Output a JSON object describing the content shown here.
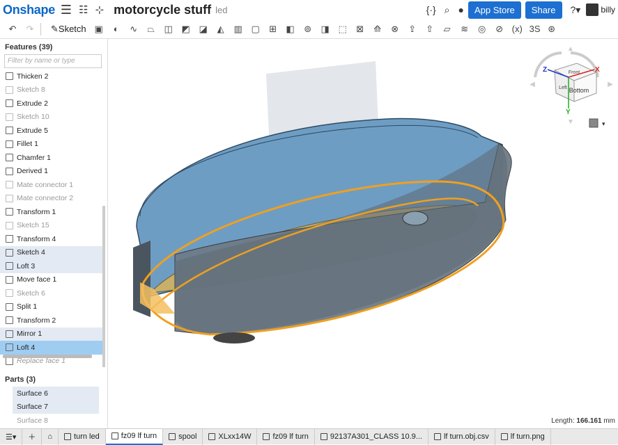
{
  "header": {
    "logo": "Onshape",
    "doc_title": "motorcycle stuff",
    "doc_subtitle": "led",
    "app_store": "App Store",
    "share": "Share",
    "user": "billy"
  },
  "toolbar": {
    "sketch": "Sketch"
  },
  "features": {
    "heading": "Features (39)",
    "filter_placeholder": "Filter by name or type",
    "items": [
      {
        "label": "Thicken 2",
        "state": "normal"
      },
      {
        "label": "Sketch 8",
        "state": "dim"
      },
      {
        "label": "Extrude 2",
        "state": "normal"
      },
      {
        "label": "Sketch 10",
        "state": "dim"
      },
      {
        "label": "Extrude 5",
        "state": "normal"
      },
      {
        "label": "Fillet 1",
        "state": "normal"
      },
      {
        "label": "Chamfer 1",
        "state": "normal"
      },
      {
        "label": "Derived 1",
        "state": "normal"
      },
      {
        "label": "Mate connector 1",
        "state": "dim"
      },
      {
        "label": "Mate connector 2",
        "state": "dim"
      },
      {
        "label": "Transform 1",
        "state": "normal"
      },
      {
        "label": "Sketch 15",
        "state": "dim"
      },
      {
        "label": "Transform 4",
        "state": "normal"
      },
      {
        "label": "Sketch 4",
        "state": "hl"
      },
      {
        "label": "Loft 3",
        "state": "hl"
      },
      {
        "label": "Move face 1",
        "state": "normal"
      },
      {
        "label": "Sketch 6",
        "state": "dim"
      },
      {
        "label": "Split 1",
        "state": "normal"
      },
      {
        "label": "Transform 2",
        "state": "normal"
      },
      {
        "label": "Mirror 1",
        "state": "hl"
      },
      {
        "label": "Loft 4",
        "state": "sel"
      },
      {
        "label": "Replace face 1",
        "state": "ital"
      }
    ]
  },
  "parts": {
    "heading": "Parts (3)",
    "items": [
      {
        "label": "Surface 6",
        "state": "hl"
      },
      {
        "label": "Surface 7",
        "state": "hl"
      },
      {
        "label": "Surface 8",
        "state": "dim"
      }
    ]
  },
  "viewcube": {
    "bottom": "Bottom",
    "front": "Front",
    "left": "Left",
    "x": "X",
    "y": "Y",
    "z": "Z"
  },
  "status": {
    "length_label": "Length:",
    "length_value": "166.161",
    "length_unit": "mm"
  },
  "tabs": [
    {
      "label": "turn led",
      "active": false
    },
    {
      "label": "fz09 lf turn",
      "active": true
    },
    {
      "label": "spool",
      "active": false
    },
    {
      "label": "XLxx14W",
      "active": false
    },
    {
      "label": "fz09 lf turn",
      "active": false
    },
    {
      "label": "92137A301_CLASS 10.9...",
      "active": false
    },
    {
      "label": "lf turn.obj.csv",
      "active": false
    },
    {
      "label": "lf turn.png",
      "active": false
    }
  ]
}
